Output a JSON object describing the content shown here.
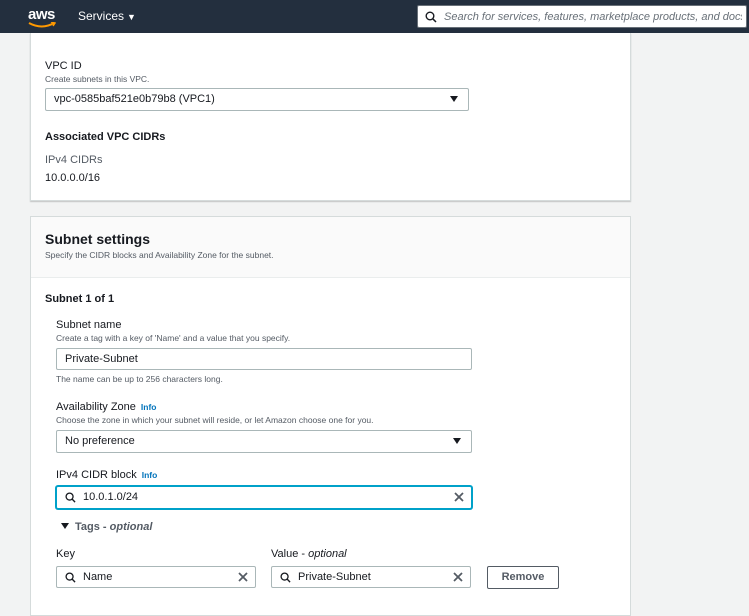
{
  "nav": {
    "logo_text": "aws",
    "services_label": "Services",
    "search_placeholder": "Search for services, features, marketplace products, and docs"
  },
  "vpc": {
    "label": "VPC ID",
    "description": "Create subnets in this VPC.",
    "selected": "vpc-0585baf521e0b79b8 (VPC1)",
    "cidr_heading": "Associated VPC CIDRs",
    "ipv4_label": "IPv4 CIDRs",
    "ipv4_value": "10.0.0.0/16"
  },
  "subnet_settings": {
    "title": "Subnet settings",
    "description": "Specify the CIDR blocks and Availability Zone for the subnet.",
    "subnet_heading": "Subnet 1 of 1",
    "name_label": "Subnet name",
    "name_description": "Create a tag with a key of 'Name' and a value that you specify.",
    "name_value": "Private-Subnet",
    "name_hint": "The name can be up to 256 characters long.",
    "az_label": "Availability Zone",
    "az_info": "Info",
    "az_description": "Choose the zone in which your subnet will reside, or let Amazon choose one for you.",
    "az_selected": "No preference",
    "cidr_label": "IPv4 CIDR block",
    "cidr_info": "Info",
    "cidr_value": "10.0.1.0/24"
  },
  "tags": {
    "toggle_label": "Tags - ",
    "toggle_optional": "optional",
    "key_label": "Key",
    "value_label": "Value - ",
    "value_optional": "optional",
    "key_value": "Name",
    "value_value": "Private-Subnet",
    "remove_label": "Remove"
  },
  "colors": {
    "nav_bg": "#232f3e",
    "link": "#0073bb",
    "focus": "#00a1c9"
  }
}
